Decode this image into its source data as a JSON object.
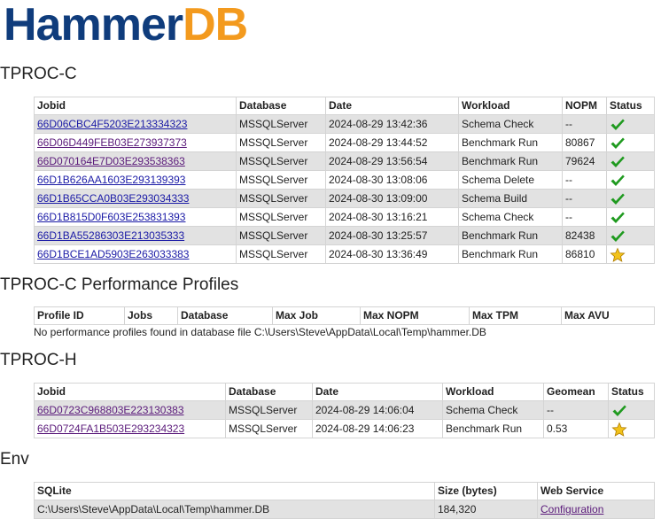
{
  "logo": {
    "part1": "Hammer",
    "part2": "DB"
  },
  "tprocc": {
    "title": "TPROC-C",
    "headers": [
      "Jobid",
      "Database",
      "Date",
      "Workload",
      "NOPM",
      "Status"
    ],
    "rows": [
      {
        "jobid": "66D06CBC4F5203E213334323",
        "database": "MSSQLServer",
        "date": "2024-08-29 13:42:36",
        "workload": "Schema Check",
        "nopm": "--",
        "status": "check",
        "visited": false
      },
      {
        "jobid": "66D06D449FEB03E273937373",
        "database": "MSSQLServer",
        "date": "2024-08-29 13:44:52",
        "workload": "Benchmark Run",
        "nopm": "80867",
        "status": "check",
        "visited": true
      },
      {
        "jobid": "66D070164E7D03E293538363",
        "database": "MSSQLServer",
        "date": "2024-08-29 13:56:54",
        "workload": "Benchmark Run",
        "nopm": "79624",
        "status": "check",
        "visited": true
      },
      {
        "jobid": "66D1B626AA1603E293139393",
        "database": "MSSQLServer",
        "date": "2024-08-30 13:08:06",
        "workload": "Schema Delete",
        "nopm": "--",
        "status": "check",
        "visited": false
      },
      {
        "jobid": "66D1B65CCA0B03E293034333",
        "database": "MSSQLServer",
        "date": "2024-08-30 13:09:00",
        "workload": "Schema Build",
        "nopm": "--",
        "status": "check",
        "visited": false
      },
      {
        "jobid": "66D1B815D0F603E253831393",
        "database": "MSSQLServer",
        "date": "2024-08-30 13:16:21",
        "workload": "Schema Check",
        "nopm": "--",
        "status": "check",
        "visited": false
      },
      {
        "jobid": "66D1BA55286303E213035333",
        "database": "MSSQLServer",
        "date": "2024-08-30 13:25:57",
        "workload": "Benchmark Run",
        "nopm": "82438",
        "status": "check",
        "visited": false
      },
      {
        "jobid": "66D1BCE1AD5903E263033383",
        "database": "MSSQLServer",
        "date": "2024-08-30 13:36:49",
        "workload": "Benchmark Run",
        "nopm": "86810",
        "status": "star",
        "visited": false
      }
    ]
  },
  "profiles": {
    "title": "TPROC-C Performance Profiles",
    "headers": [
      "Profile ID",
      "Jobs",
      "Database",
      "Max Job",
      "Max NOPM",
      "Max TPM",
      "Max AVU"
    ],
    "empty_message": "No performance profiles found in database file C:\\Users\\Steve\\AppData\\Local\\Temp\\hammer.DB"
  },
  "tproch": {
    "title": "TPROC-H",
    "headers": [
      "Jobid",
      "Database",
      "Date",
      "Workload",
      "Geomean",
      "Status"
    ],
    "rows": [
      {
        "jobid": "66D0723C968803E223130383",
        "database": "MSSQLServer",
        "date": "2024-08-29 14:06:04",
        "workload": "Schema Check",
        "geomean": "--",
        "status": "check",
        "visited": true
      },
      {
        "jobid": "66D0724FA1B503E293234323",
        "database": "MSSQLServer",
        "date": "2024-08-29 14:06:23",
        "workload": "Benchmark Run",
        "geomean": "0.53",
        "status": "star",
        "visited": true
      }
    ]
  },
  "env": {
    "title": "Env",
    "headers": [
      "SQLite",
      "Size (bytes)",
      "Web Service"
    ],
    "row": {
      "path": "C:\\Users\\Steve\\AppData\\Local\\Temp\\hammer.DB",
      "size": "184,320",
      "service": "Configuration"
    }
  },
  "colors": {
    "logo_primary": "#0f3c7c",
    "logo_accent": "#f39a1e",
    "row_shade": "#e2e2e2",
    "link": "#1a1aa6",
    "link_visited": "#5a1a7a",
    "check": "#1f9a1f",
    "star": "#f2c21a"
  }
}
